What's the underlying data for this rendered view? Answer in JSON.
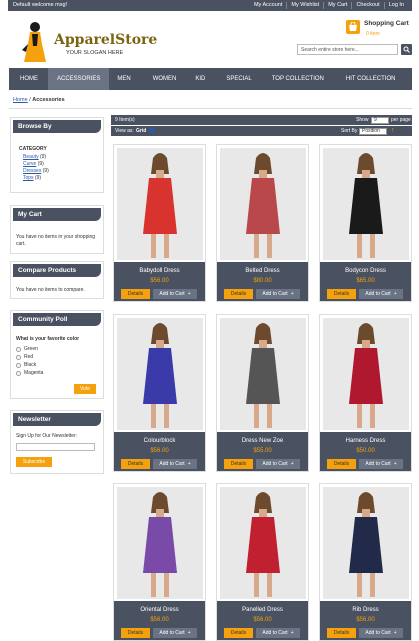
{
  "topbar": {
    "welcome": "Default welcome msg!",
    "links": [
      "My Account",
      "My Wishlist",
      "My Cart",
      "Checkout",
      "Log In"
    ]
  },
  "logo": {
    "name": "ApparelStore",
    "slogan": "YOUR SLOGAN HERE"
  },
  "cart": {
    "title": "Shopping Cart",
    "count": "0 item"
  },
  "search": {
    "placeholder": "Search entire store here..."
  },
  "nav": [
    "HOME",
    "ACCESSORIES",
    "MEN",
    "WOMEN",
    "KID",
    "SPECIAL",
    "TOP COLLECTION",
    "HIT COLLECTION"
  ],
  "nav_active": "ACCESSORIES",
  "breadcrumb": {
    "home": "Home",
    "sep": " / ",
    "current": "Accessories"
  },
  "browse": {
    "title": "Browse By",
    "category_label": "CATEGORY",
    "categories": [
      {
        "name": "Beauty",
        "count": " (9)"
      },
      {
        "name": "Curve",
        "count": " (9)"
      },
      {
        "name": "Dresses",
        "count": " (9)"
      },
      {
        "name": "Tops",
        "count": " (9)"
      }
    ]
  },
  "my_cart": {
    "title": "My Cart",
    "text": "You have no items in your shopping cart."
  },
  "compare": {
    "title": "Compare Products",
    "text": "You have no items to compare."
  },
  "poll": {
    "title": "Community Poll",
    "question": "What is your favorite color",
    "options": [
      "Green",
      "Red",
      "Black",
      "Magenta"
    ],
    "vote": "Vote"
  },
  "newsletter": {
    "title": "Newsletter",
    "label": "Sign Up for Our Newsletter:",
    "button": "Subscribe"
  },
  "toolbar": {
    "items_count": "9 Item(s)",
    "show_label": "Show",
    "show_value": "9",
    "per_page": "per page",
    "view_label": "View as:",
    "view_grid": "Grid",
    "sort_label": "Sort By",
    "sort_value": "Position"
  },
  "product_buttons": {
    "details": "Details",
    "add_to_cart": "Add to Cart"
  },
  "products": [
    {
      "name": "Babydoll Dress",
      "price": "$56.00",
      "color": "#d8332f"
    },
    {
      "name": "Belted Dress",
      "price": "$80.00",
      "color": "#b8484a"
    },
    {
      "name": "Bodycon Dress",
      "price": "$65.00",
      "color": "#1a1a1a"
    },
    {
      "name": "Colourblock",
      "price": "$56.00",
      "color": "#3a3aa8"
    },
    {
      "name": "Dress New Zoe",
      "price": "$55.00",
      "color": "#555555"
    },
    {
      "name": "Harness Dress",
      "price": "$50.00",
      "color": "#b01830"
    },
    {
      "name": "Oriental Dress",
      "price": "$56.00",
      "color": "#7a4aa8"
    },
    {
      "name": "Panelled Dress",
      "price": "$56.00",
      "color": "#c02030"
    },
    {
      "name": "Rib Dress",
      "price": "$56.00",
      "color": "#222a4a"
    }
  ],
  "colors": {
    "accent": "#f4a10d",
    "dark": "#4a5261",
    "link": "#2a5aa8"
  }
}
